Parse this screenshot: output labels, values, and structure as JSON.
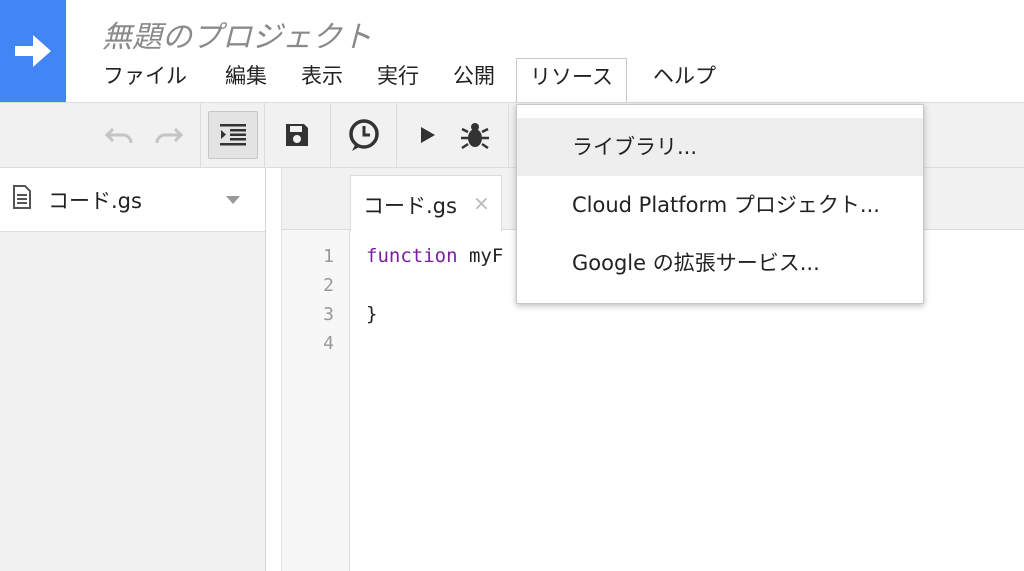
{
  "header": {
    "project_title": "無題のプロジェクト",
    "brand_color": "#4285f4"
  },
  "menubar": {
    "items": [
      "ファイル",
      "編集",
      "表示",
      "実行",
      "公開",
      "リソース",
      "ヘルプ"
    ],
    "active": "リソース"
  },
  "toolbar": {
    "buttons": [
      "undo-icon",
      "redo-icon",
      "indent-icon",
      "save-icon",
      "trigger-clock-icon",
      "run-icon",
      "debug-icon"
    ]
  },
  "sidebar": {
    "file_name": "コード.gs"
  },
  "editor": {
    "tab_label": "コード.gs",
    "tab_close": "×",
    "line_numbers": [
      "1",
      "2",
      "3",
      "4"
    ],
    "code_keyword": "function",
    "code_rest_line1": " myF",
    "code_line3": "}"
  },
  "dropdown": {
    "items": [
      "ライブラリ...",
      "Cloud Platform プロジェクト...",
      "Google の拡張サービス..."
    ]
  }
}
